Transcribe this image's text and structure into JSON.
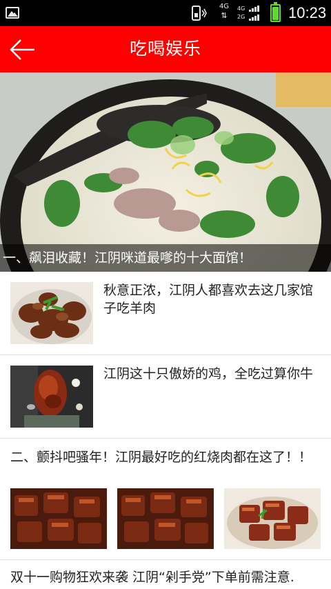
{
  "status_bar": {
    "gallery_icon": "gallery-icon",
    "network_label": "4G",
    "sim_labels": [
      "4G",
      "2G"
    ],
    "time": "10:23",
    "battery_color": "#5cdb28"
  },
  "header": {
    "title": "吃喝娱乐",
    "back_icon": "back-arrow-icon",
    "background_color": "#ff0000"
  },
  "banner": {
    "caption": "一、飙泪收藏！江阴咪道最嗲的十大面馆！"
  },
  "articles": [
    {
      "title": "秋意正浓，江阴人都喜欢去这几家馆子吃羊肉"
    },
    {
      "title": "江阴这十只傲娇的鸡，全吃过算你牛"
    }
  ],
  "multi_image_article": {
    "title": "二、颤抖吧骚年！江阴最好吃的红烧肉都在这了！！"
  },
  "text_article": {
    "title": "双十一购物狂欢来袭 江阴“剁手党”下单前需注意."
  }
}
